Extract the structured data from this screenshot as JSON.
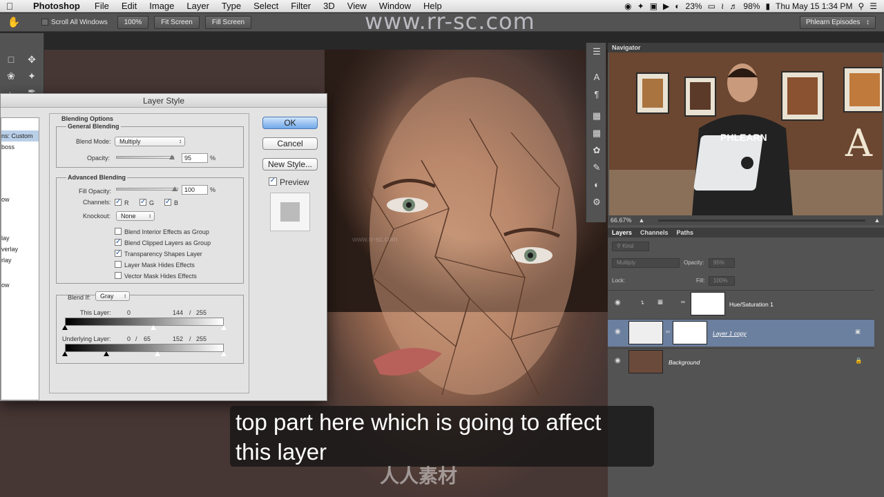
{
  "menubar": {
    "app": "Photoshop",
    "items": [
      "File",
      "Edit",
      "Image",
      "Layer",
      "Type",
      "Select",
      "Filter",
      "3D",
      "View",
      "Window",
      "Help"
    ],
    "battery_saver": "23%",
    "battery": "98%",
    "clock": "Thu May 15  1:34 PM"
  },
  "options_bar": {
    "scroll_all": "Scroll All Windows",
    "btn_100": "100%",
    "btn_fit": "Fit Screen",
    "btn_fill": "Fill Screen",
    "workspace": "Phlearn Episodes"
  },
  "watermark_top": "www.rr-sc.com",
  "watermark_bottom": "人人素材",
  "dialog": {
    "title": "Layer Style",
    "styles_list": [
      "ns: Custom",
      "boss",
      "ow",
      "lay",
      "verlay",
      "rlay",
      "ow"
    ],
    "blending_options": "Blending Options",
    "general_blending": "General Blending",
    "blend_mode_label": "Blend Mode:",
    "blend_mode_value": "Multiply",
    "opacity_label": "Opacity:",
    "opacity_value": "95",
    "opacity_unit": "%",
    "advanced_blending": "Advanced Blending",
    "fill_opacity_label": "Fill Opacity:",
    "fill_opacity_value": "100",
    "fill_unit": "%",
    "channels_label": "Channels:",
    "channel_r": "R",
    "channel_g": "G",
    "channel_b": "B",
    "knockout_label": "Knockout:",
    "knockout_value": "None",
    "opt1": "Blend Interior Effects as Group",
    "opt2": "Blend Clipped Layers as Group",
    "opt3": "Transparency Shapes Layer",
    "opt4": "Layer Mask Hides Effects",
    "opt5": "Vector Mask Hides Effects",
    "blend_if_label": "Blend If:",
    "blend_if_value": "Gray",
    "this_layer_label": "This Layer:",
    "this_layer_low": "0",
    "this_layer_high": "144",
    "this_layer_slash": "/",
    "this_layer_max": "255",
    "underlying_label": "Underlying Layer:",
    "under_low": "0",
    "under_slash1": "/",
    "under_low2": "65",
    "under_high": "152",
    "under_slash2": "/",
    "under_max": "255",
    "ok": "OK",
    "cancel": "Cancel",
    "new_style": "New Style...",
    "preview": "Preview"
  },
  "navigator": {
    "title": "Navigator",
    "zoom": "66.67%",
    "shirt_text": "PHLEARN",
    "letter": "A"
  },
  "layers": {
    "tabs": [
      "Layers",
      "Channels",
      "Paths"
    ],
    "kind": "Kind",
    "blend_mode": "Multiply",
    "opacity_label": "Opacity:",
    "opacity_value": "95%",
    "lock_label": "Lock:",
    "fill_label": "Fill:",
    "fill_value": "100%",
    "rows": [
      {
        "name": "Hue/Saturation 1"
      },
      {
        "name": "Layer 1 copy"
      },
      {
        "name": "Background"
      }
    ]
  },
  "subtitle": {
    "line1": "top part here which is going to affect",
    "line2": "this layer"
  }
}
